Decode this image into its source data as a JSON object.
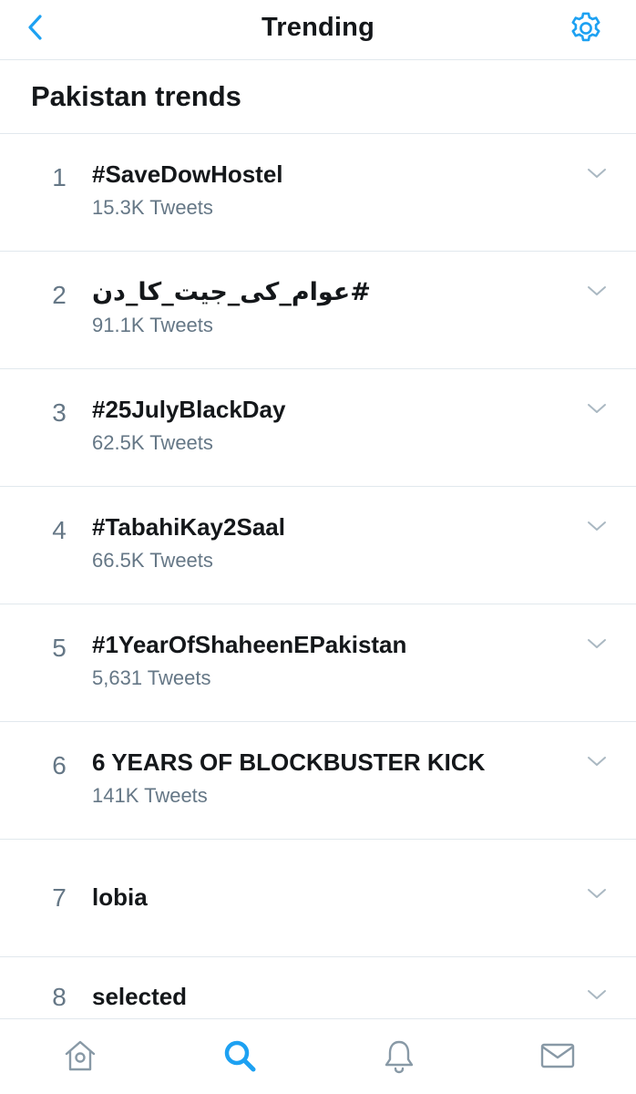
{
  "header": {
    "title": "Trending",
    "back_icon": "chevron-left-icon",
    "settings_icon": "gear-icon",
    "accent_color": "#1da1f2"
  },
  "section": {
    "title": "Pakistan trends"
  },
  "trends": [
    {
      "rank": "1",
      "name": "#SaveDowHostel",
      "count": "15.3K Tweets"
    },
    {
      "rank": "2",
      "name": "#عوام_کی_جیت_کا_دن",
      "count": "91.1K Tweets"
    },
    {
      "rank": "3",
      "name": "#25JulyBlackDay",
      "count": "62.5K Tweets"
    },
    {
      "rank": "4",
      "name": "#TabahiKay2Saal",
      "count": "66.5K Tweets"
    },
    {
      "rank": "5",
      "name": "#1YearOfShaheenEPakistan",
      "count": "5,631 Tweets"
    },
    {
      "rank": "6",
      "name": "6 YEARS OF BLOCKBUSTER KICK",
      "count": "141K Tweets"
    },
    {
      "rank": "7",
      "name": "lobia"
    },
    {
      "rank": "8",
      "name": "selected"
    }
  ],
  "bottom_nav": {
    "items": [
      {
        "icon": "home-icon",
        "active": false
      },
      {
        "icon": "search-icon",
        "active": true
      },
      {
        "icon": "bell-icon",
        "active": false
      },
      {
        "icon": "mail-icon",
        "active": false
      }
    ]
  },
  "colors": {
    "text_primary": "#14171a",
    "text_secondary": "#657786",
    "divider": "#e1e8ed",
    "icon_gray": "#8899a6"
  }
}
